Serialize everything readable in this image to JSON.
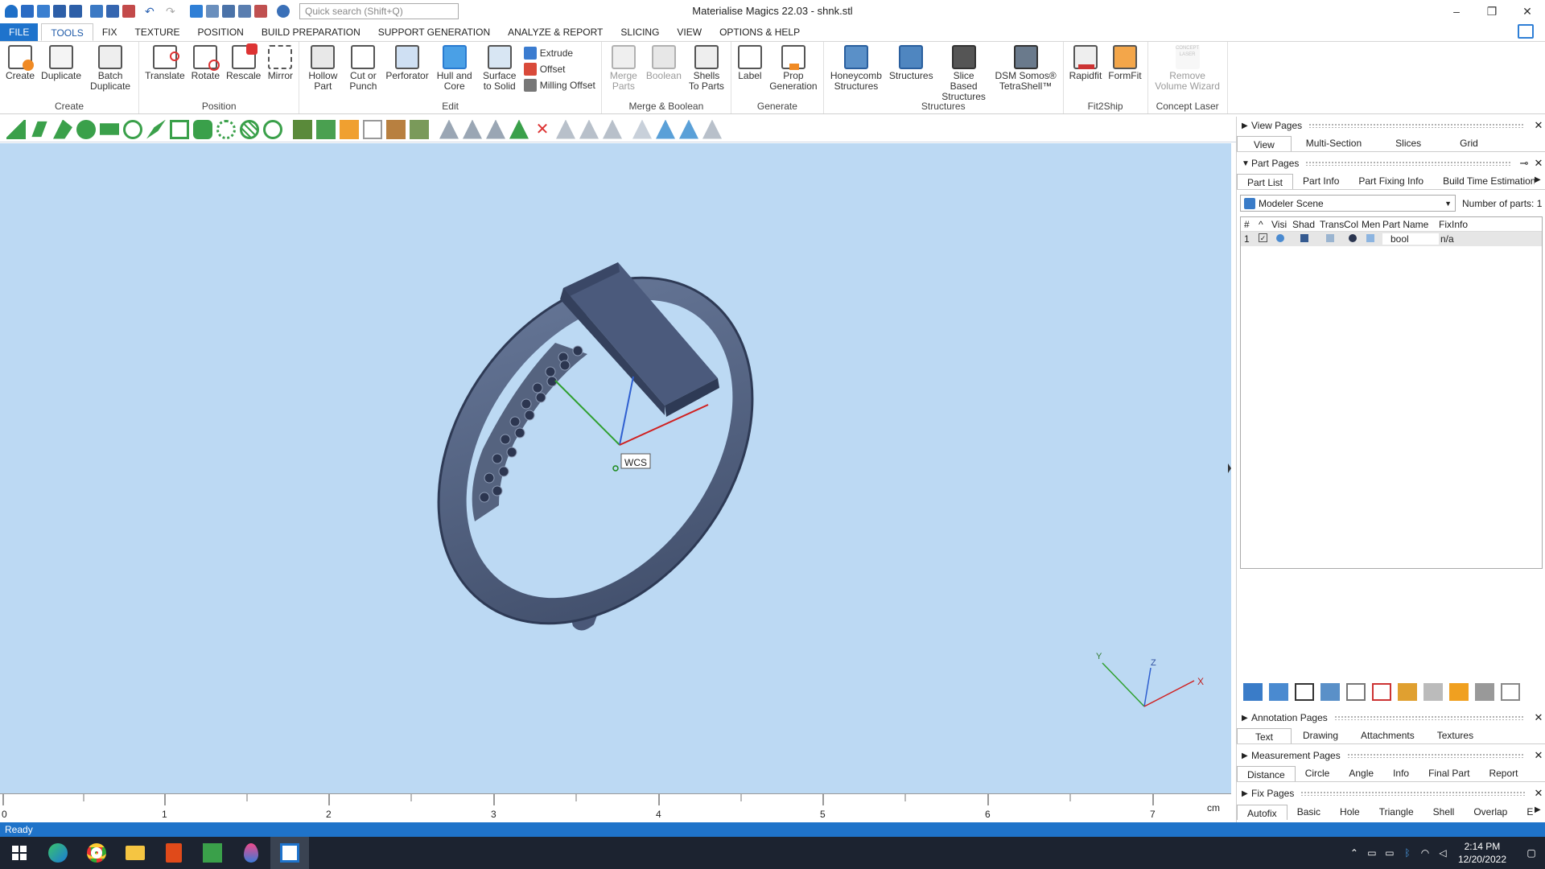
{
  "app": {
    "title": "Materialise Magics 22.03 - shnk.stl",
    "search_placeholder": "Quick search (Shift+Q)"
  },
  "menu": {
    "tabs": [
      "FILE",
      "TOOLS",
      "FIX",
      "TEXTURE",
      "POSITION",
      "BUILD PREPARATION",
      "SUPPORT GENERATION",
      "ANALYZE & REPORT",
      "SLICING",
      "VIEW",
      "OPTIONS & HELP"
    ],
    "active": "TOOLS"
  },
  "ribbon": {
    "create": {
      "name": "Create",
      "buttons": [
        "Create",
        "Duplicate",
        "Batch Duplicate"
      ]
    },
    "position": {
      "name": "Position",
      "buttons": [
        "Translate",
        "Rotate",
        "Rescale",
        "Mirror"
      ]
    },
    "edit": {
      "name": "Edit",
      "buttons": [
        "Hollow Part",
        "Cut or Punch",
        "Perforator",
        "Hull and Core",
        "Surface to Solid"
      ],
      "small": [
        "Extrude",
        "Offset",
        "Milling Offset"
      ]
    },
    "merge": {
      "name": "Merge & Boolean",
      "buttons": [
        "Merge Parts",
        "Boolean",
        "Shells To Parts"
      ]
    },
    "generate": {
      "name": "Generate",
      "buttons": [
        "Label",
        "Prop Generation"
      ]
    },
    "structures": {
      "name": "Structures",
      "buttons": [
        "Honeycomb Structures",
        "Structures",
        "Slice Based Structures",
        "DSM Somos® TetraShell™"
      ]
    },
    "fit2ship": {
      "name": "Fit2Ship",
      "buttons": [
        "Rapidfit",
        "FormFit"
      ]
    },
    "concept": {
      "name": "Concept Laser",
      "buttons": [
        "Remove Volume Wizard"
      ],
      "icon_text": "CONCEPT LASER"
    }
  },
  "viewport": {
    "wcs_label": "WCS",
    "axis_x": "X",
    "axis_y": "Y",
    "axis_z": "Z"
  },
  "ruler": {
    "labels": [
      "0",
      "1",
      "2",
      "3",
      "4",
      "5",
      "6",
      "7"
    ],
    "unit": "cm"
  },
  "status": "Ready",
  "right_panel": {
    "view_pages": {
      "title": "View Pages",
      "tabs": [
        "View",
        "Multi-Section",
        "Slices",
        "Grid"
      ]
    },
    "part_pages": {
      "title": "Part Pages",
      "tabs": [
        "Part List",
        "Part Info",
        "Part Fixing Info",
        "Build Time Estimation"
      ],
      "scene": "Modeler Scene",
      "num_parts_label": "Number of parts:",
      "num_parts": "1",
      "columns": [
        "#",
        "^",
        "Visi",
        "Shad",
        "Trans",
        "Col",
        "Men",
        "Part Name",
        "FixInfo"
      ],
      "rows": [
        {
          "num": "1",
          "name": "bool",
          "fixinfo": "n/a"
        }
      ]
    },
    "annotation_pages": {
      "title": "Annotation Pages",
      "tabs": [
        "Text",
        "Drawing",
        "Attachments",
        "Textures"
      ]
    },
    "measurement_pages": {
      "title": "Measurement Pages",
      "tabs": [
        "Distance",
        "Circle",
        "Angle",
        "Info",
        "Final Part",
        "Report"
      ]
    },
    "fix_pages": {
      "title": "Fix Pages",
      "tabs": [
        "Autofix",
        "Basic",
        "Hole",
        "Triangle",
        "Shell",
        "Overlap",
        "E"
      ]
    }
  },
  "taskbar": {
    "time": "2:14 PM",
    "date": "12/20/2022"
  }
}
